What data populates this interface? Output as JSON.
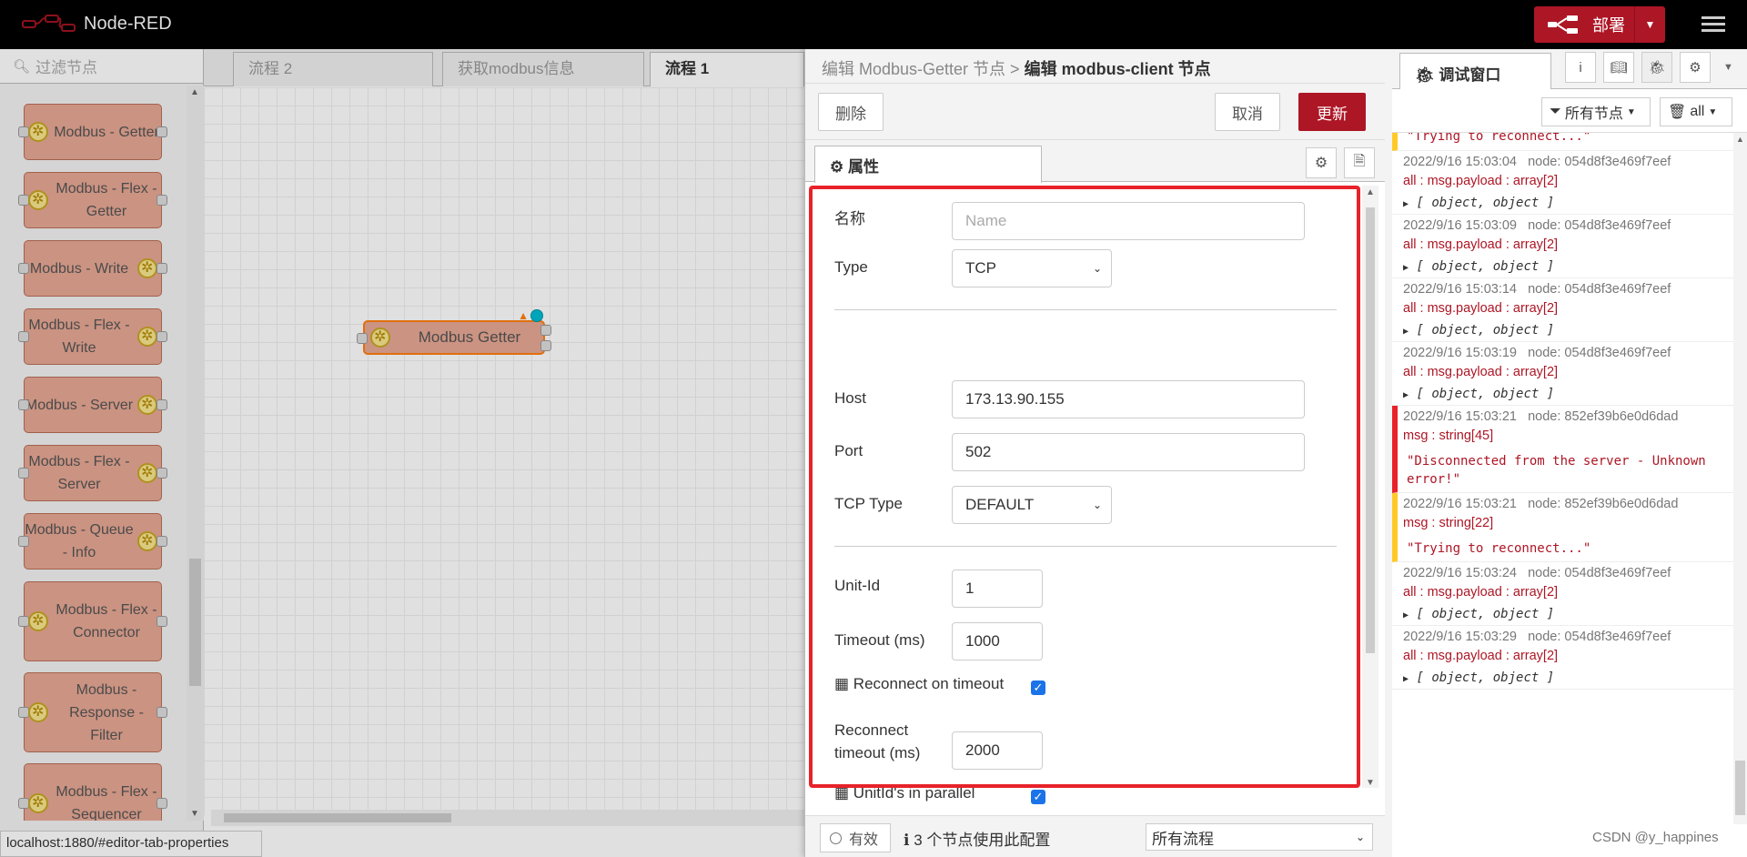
{
  "header": {
    "app_title": "Node-RED",
    "deploy_label": "部署"
  },
  "palette": {
    "search_placeholder": "过滤节点",
    "nodes": [
      {
        "label": "Modbus - Getter"
      },
      {
        "label": "Modbus - Flex - Getter"
      },
      {
        "label": "Modbus - Write"
      },
      {
        "label": "Modbus - Flex - Write"
      },
      {
        "label": "Modbus - Server"
      },
      {
        "label": "Modbus - Flex - Server"
      },
      {
        "label": "Modbus - Queue - Info"
      },
      {
        "label": "Modbus - Flex - Connector"
      },
      {
        "label": "Modbus - Response - Filter"
      },
      {
        "label": "Modbus - Flex - Sequencer"
      }
    ]
  },
  "workspace": {
    "tabs": [
      {
        "label": "流程 2",
        "active": false
      },
      {
        "label": "获取modbus信息",
        "active": false
      },
      {
        "label": "流程 1",
        "active": true
      }
    ],
    "node_label": "Modbus Getter"
  },
  "status_url": "localhost:1880/#editor-tab-properties",
  "tray": {
    "breadcrumb_parent": "编辑 Modbus-Getter 节点 >",
    "breadcrumb_current": "编辑 modbus-client 节点",
    "delete_label": "删除",
    "cancel_label": "取消",
    "update_label": "更新",
    "properties_tab": "属性",
    "fields": {
      "name_label": "名称",
      "name_placeholder": "Name",
      "type_label": "Type",
      "type_value": "TCP",
      "host_label": "Host",
      "host_value": "173.13.90.155",
      "port_label": "Port",
      "port_value": "502",
      "tcp_type_label": "TCP Type",
      "tcp_type_value": "DEFAULT",
      "unit_id_label": "Unit-Id",
      "unit_id_value": "1",
      "timeout_label": "Timeout (ms)",
      "timeout_value": "1000",
      "reconnect_on_timeout_label": "Reconnect on timeout",
      "reconnect_timeout_label_1": "Reconnect",
      "reconnect_timeout_label_2": "timeout (ms)",
      "reconnect_timeout_value": "2000",
      "unitids_parallel_label": "UnitId's in parallel"
    },
    "footer": {
      "enabled_label": "有效",
      "usage_text": "3 个节点使用此配置",
      "scope_value": "所有流程"
    }
  },
  "sidebar": {
    "tab_label": "调试窗口",
    "filter_nodes_label": "所有节点",
    "filter_all_label": "all",
    "partial_top": "\"Trying to reconnect...\"",
    "messages": [
      {
        "kind": "normal",
        "time": "2022/9/16 15:03:04",
        "node": "node: 054d8f3e469f7eef",
        "topic": "all : msg.payload : array[2]",
        "value": "[ object, object ]"
      },
      {
        "kind": "normal",
        "time": "2022/9/16 15:03:09",
        "node": "node: 054d8f3e469f7eef",
        "topic": "all : msg.payload : array[2]",
        "value": "[ object, object ]"
      },
      {
        "kind": "normal",
        "time": "2022/9/16 15:03:14",
        "node": "node: 054d8f3e469f7eef",
        "topic": "all : msg.payload : array[2]",
        "value": "[ object, object ]"
      },
      {
        "kind": "normal",
        "time": "2022/9/16 15:03:19",
        "node": "node: 054d8f3e469f7eef",
        "topic": "all : msg.payload : array[2]",
        "value": "[ object, object ]"
      },
      {
        "kind": "err",
        "time": "2022/9/16 15:03:21",
        "node": "node: 852ef39b6e0d6dad",
        "topic": "msg : string[45]",
        "value": "\"Disconnected from the server - Unknown error!\""
      },
      {
        "kind": "warn",
        "time": "2022/9/16 15:03:21",
        "node": "node: 852ef39b6e0d6dad",
        "topic": "msg : string[22]",
        "value": "\"Trying to reconnect...\""
      },
      {
        "kind": "normal",
        "time": "2022/9/16 15:03:24",
        "node": "node: 054d8f3e469f7eef",
        "topic": "all : msg.payload : array[2]",
        "value": "[ object, object ]"
      },
      {
        "kind": "normal",
        "time": "2022/9/16 15:03:29",
        "node": "node: 054d8f3e469f7eef",
        "topic": "all : msg.payload : array[2]",
        "value": "[ object, object ]"
      }
    ]
  },
  "watermark": "CSDN @y_happines",
  "colors": {
    "accent": "#AD1625",
    "highlight_box": "#e8222a",
    "node_fill": "#e7a894"
  }
}
